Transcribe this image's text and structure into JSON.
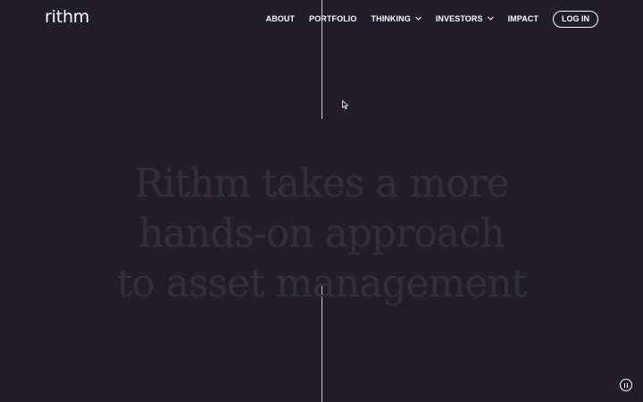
{
  "brand": {
    "logo_text": "rithm"
  },
  "nav": {
    "items": [
      {
        "label": "ABOUT",
        "has_dropdown": false
      },
      {
        "label": "PORTFOLIO",
        "has_dropdown": false
      },
      {
        "label": "THINKING",
        "has_dropdown": true
      },
      {
        "label": "INVESTORS",
        "has_dropdown": true
      },
      {
        "label": "IMPACT",
        "has_dropdown": false
      }
    ],
    "login_label": "LOG IN"
  },
  "hero": {
    "headline_lines": [
      "Rithm takes a more",
      "hands-on approach",
      "to asset management"
    ]
  },
  "controls": {
    "pause_icon": "pause-icon"
  },
  "colors": {
    "background": "#211d2b",
    "nav_text": "#ffffff",
    "headline_text": "#322e3b",
    "divider_line": "#cdc9d4"
  }
}
